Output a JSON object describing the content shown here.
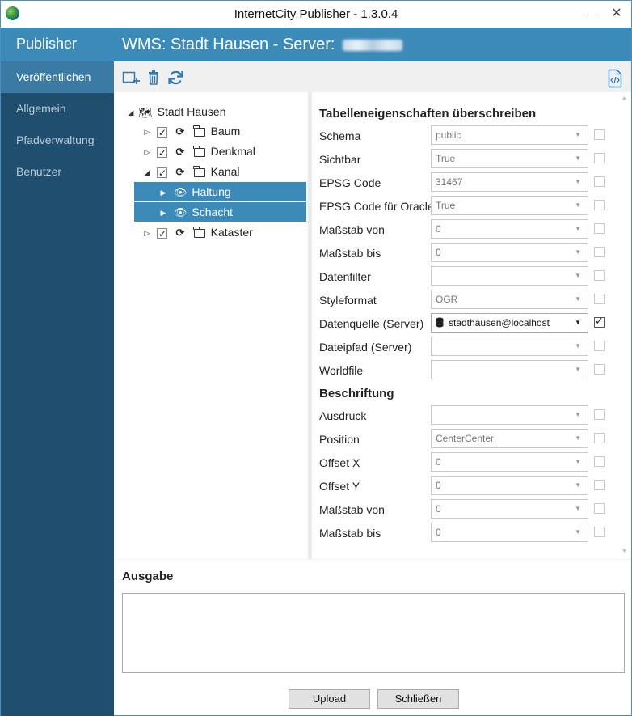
{
  "window": {
    "title": "InternetCity Publisher - 1.3.0.4",
    "minimize": "—",
    "close": "✕"
  },
  "sidebar": {
    "header": "Publisher",
    "items": [
      {
        "label": "Veröffentlichen",
        "active": true
      },
      {
        "label": "Allgemein"
      },
      {
        "label": "Pfadverwaltung"
      },
      {
        "label": "Benutzer"
      }
    ]
  },
  "header": {
    "title": "WMS: Stadt Hausen - Server:"
  },
  "toolbar": {
    "icons": [
      "add-layer-icon",
      "delete-icon",
      "refresh-icon",
      "code-file-icon"
    ]
  },
  "tree": {
    "root": "Stadt Hausen",
    "nodes": [
      "Baum",
      "Denkmal",
      "Kanal",
      "Haltung",
      "Schacht",
      "Kataster"
    ]
  },
  "props": {
    "section1": "Tabelleneigenschaften überschreiben",
    "rows": [
      {
        "label": "Schema",
        "value": "public"
      },
      {
        "label": "Sichtbar",
        "value": "True"
      },
      {
        "label": "EPSG Code",
        "value": "31467"
      },
      {
        "label": "EPSG Code für Oracle",
        "value": "True"
      },
      {
        "label": "Maßstab von",
        "value": "0"
      },
      {
        "label": "Maßstab bis",
        "value": "0"
      },
      {
        "label": "Datenfilter",
        "value": ""
      },
      {
        "label": "Styleformat",
        "value": "OGR"
      },
      {
        "label": "Datenquelle (Server)",
        "value": "stadthausen@localhost",
        "checked": true
      },
      {
        "label": "Dateipfad (Server)",
        "value": ""
      },
      {
        "label": "Worldfile",
        "value": ""
      }
    ],
    "section2": "Beschriftung",
    "rows2": [
      {
        "label": "Ausdruck",
        "value": ""
      },
      {
        "label": "Position",
        "value": "CenterCenter"
      },
      {
        "label": "Offset X",
        "value": "0"
      },
      {
        "label": "Offset Y",
        "value": "0"
      },
      {
        "label": "Maßstab von",
        "value": "0"
      },
      {
        "label": "Maßstab bis",
        "value": "0"
      }
    ]
  },
  "output": {
    "title": "Ausgabe"
  },
  "footer": {
    "upload": "Upload",
    "close": "Schließen"
  }
}
